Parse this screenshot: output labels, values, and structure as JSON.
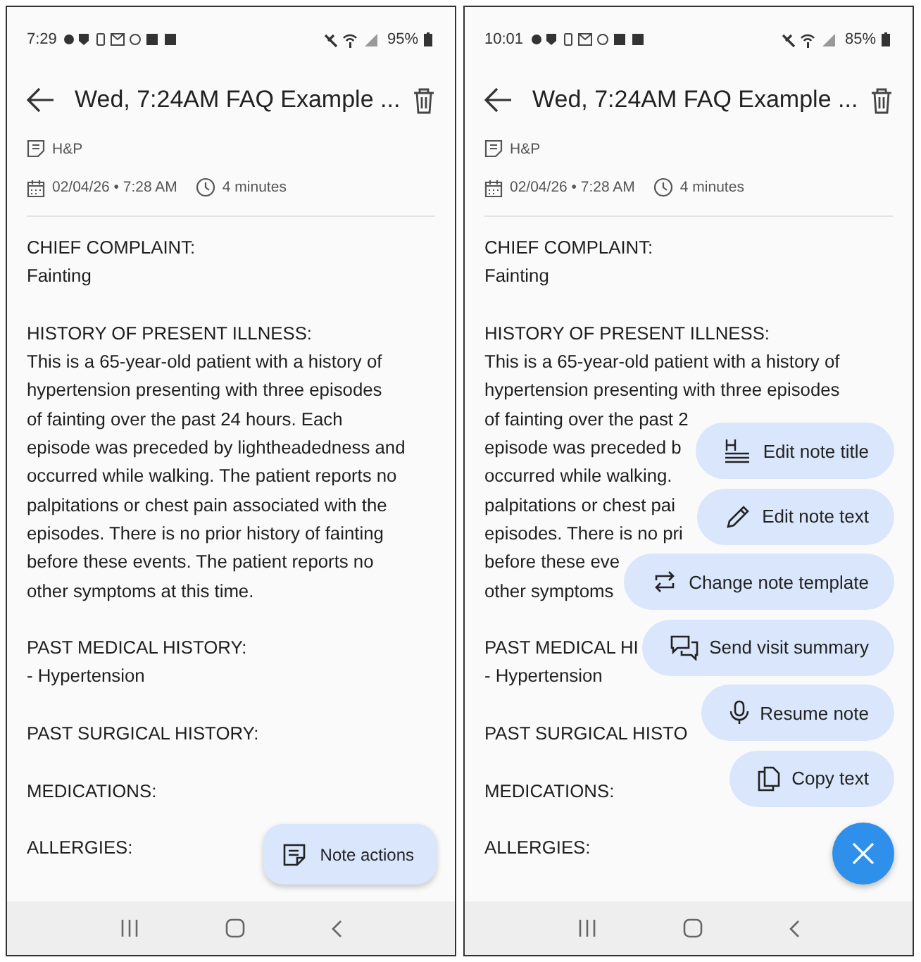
{
  "phones": [
    {
      "status_bar": {
        "time": "7:29",
        "battery": "95%"
      },
      "header": {
        "title": "Wed, 7:24AM FAQ Example ..."
      },
      "template": "H&P",
      "date": "02/04/26 • 7:28 AM",
      "duration": "4 minutes",
      "sections": [
        {
          "heading": "CHIEF COMPLAINT:",
          "lines": [
            "Fainting"
          ]
        },
        {
          "heading": "HISTORY OF PRESENT ILLNESS:",
          "lines": [
            "This is a 65-year-old patient with a history of",
            "hypertension presenting with three episodes",
            "of fainting over the past 24 hours. Each",
            "episode was preceded by lightheadedness and",
            "occurred while walking. The patient reports no",
            "palpitations or chest pain associated with the",
            "episodes. There is no prior history of fainting",
            "before these events. The patient reports no",
            "other symptoms at this time."
          ]
        },
        {
          "heading": "PAST MEDICAL HISTORY:",
          "lines": [
            "- Hypertension"
          ]
        },
        {
          "heading": "PAST SURGICAL HISTORY:"
        },
        {
          "heading": "MEDICATIONS:"
        },
        {
          "heading": "ALLERGIES:"
        }
      ],
      "fab": {
        "kind": "extended",
        "label": "Note actions"
      }
    },
    {
      "status_bar": {
        "time": "10:01",
        "battery": "85%"
      },
      "header": {
        "title": "Wed, 7:24AM FAQ Example ..."
      },
      "template": "H&P",
      "date": "02/04/26 • 7:28 AM",
      "duration": "4 minutes",
      "sections": [
        {
          "heading": "CHIEF COMPLAINT:",
          "lines": [
            "Fainting"
          ]
        },
        {
          "heading": "HISTORY OF PRESENT ILLNESS:",
          "lines": [
            "This is a 65-year-old patient with a history of",
            "hypertension presenting with three episodes",
            "of fainting over the past 2",
            "episode was preceded b",
            "occurred while walking.",
            "palpitations or chest pai",
            "episodes. There is no pri",
            "before these eve",
            "other symptoms"
          ]
        },
        {
          "heading": "PAST MEDICAL HI",
          "lines": [
            "- Hypertension"
          ]
        },
        {
          "heading": "PAST SURGICAL HISTO"
        },
        {
          "heading": "MEDICATIONS:"
        },
        {
          "heading": "ALLERGIES:"
        }
      ],
      "menu": [
        {
          "kind": "title",
          "label": "Edit note title"
        },
        {
          "kind": "edit",
          "label": "Edit note text"
        },
        {
          "kind": "template",
          "label": "Change note template"
        },
        {
          "kind": "summary",
          "label": "Send visit summary"
        },
        {
          "kind": "resume",
          "label": "Resume note"
        },
        {
          "kind": "copy",
          "label": "Copy text"
        }
      ],
      "fab": {
        "kind": "close"
      }
    }
  ]
}
